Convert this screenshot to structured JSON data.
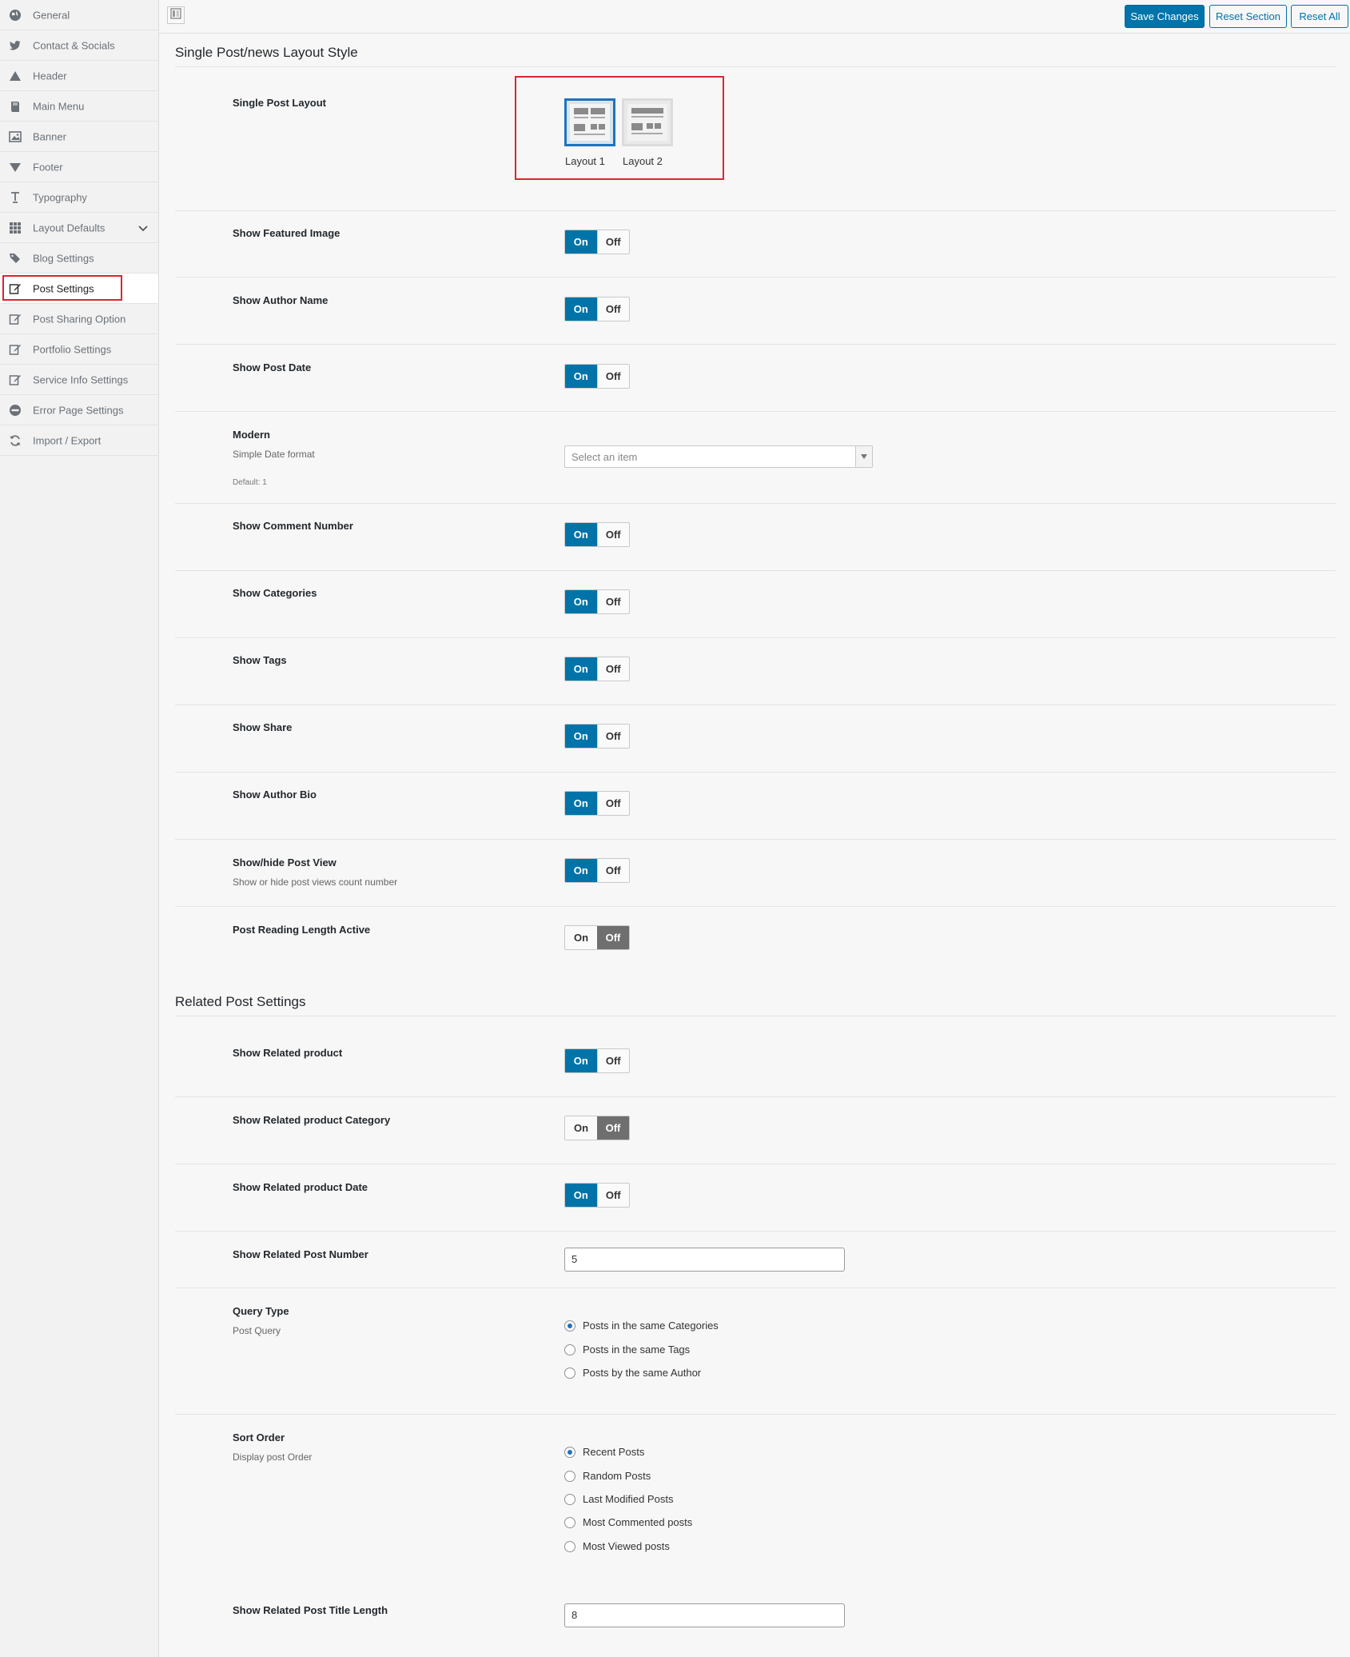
{
  "sidebar": {
    "items": [
      {
        "label": "General",
        "icon": "globe-icon"
      },
      {
        "label": "Contact & Socials",
        "icon": "twitter-icon"
      },
      {
        "label": "Header",
        "icon": "triangle-icon"
      },
      {
        "label": "Main Menu",
        "icon": "book-icon"
      },
      {
        "label": "Banner",
        "icon": "image-icon"
      },
      {
        "label": "Footer",
        "icon": "down-triangle-icon"
      },
      {
        "label": "Typography",
        "icon": "text-icon"
      },
      {
        "label": "Layout Defaults",
        "icon": "grid-icon"
      },
      {
        "label": "Blog Settings",
        "icon": "tags-icon"
      },
      {
        "label": "Post Settings",
        "icon": "edit-icon"
      },
      {
        "label": "Post Sharing Option",
        "icon": "edit-icon"
      },
      {
        "label": "Portfolio Settings",
        "icon": "edit-icon"
      },
      {
        "label": "Service Info Settings",
        "icon": "edit-icon"
      },
      {
        "label": "Error Page Settings",
        "icon": "minus-circle-icon"
      },
      {
        "label": "Import / Export",
        "icon": "refresh-icon"
      }
    ],
    "active_index": 9
  },
  "toolbar": {
    "save_label": "Save Changes",
    "reset_section_label": "Reset Section",
    "reset_all_label": "Reset All"
  },
  "section1": {
    "title": "Single Post/news Layout Style",
    "layout_label": "Single Post Layout",
    "layouts": [
      "Layout 1",
      "Layout 2"
    ],
    "selected_layout": 0,
    "date_format": {
      "label": "Modern",
      "sub": "Simple Date format",
      "default_note": "Default: 1",
      "placeholder": "Select an item"
    },
    "toggles": [
      {
        "label": "Show Featured Image",
        "on": true
      },
      {
        "label": "Show Author Name",
        "on": true
      },
      {
        "label": "Show Post Date",
        "on": true
      },
      {
        "label": "Show Comment Number",
        "on": true
      },
      {
        "label": "Show Categories",
        "on": true
      },
      {
        "label": "Show Tags",
        "on": true
      },
      {
        "label": "Show Share",
        "on": true
      },
      {
        "label": "Show Author Bio",
        "on": true
      },
      {
        "label": "Show/hide Post View",
        "sub": "Show or hide post views count number",
        "on": true
      },
      {
        "label": "Post Reading Length Active",
        "on": false
      }
    ]
  },
  "switch_labels": {
    "on": "On",
    "off": "Off"
  },
  "section2": {
    "title": "Related Post Settings",
    "toggles": [
      {
        "label": "Show Related product",
        "on": true
      },
      {
        "label": "Show Related product Category",
        "on": false
      },
      {
        "label": "Show Related product Date",
        "on": true
      }
    ],
    "post_number": {
      "label": "Show Related Post Number",
      "value": "5"
    },
    "query_type": {
      "label": "Query Type",
      "sub": "Post Query",
      "options": [
        "Posts in the same Categories",
        "Posts in the same Tags",
        "Posts by the same Author"
      ],
      "selected": 0
    },
    "sort_order": {
      "label": "Sort Order",
      "sub": "Display post Order",
      "options": [
        "Recent Posts",
        "Random Posts",
        "Last Modified Posts",
        "Most Commented posts",
        "Most Viewed posts"
      ],
      "selected": 0
    },
    "title_length": {
      "label": "Show Related Post Title Length",
      "value": "8"
    }
  },
  "colors": {
    "accent": "#0073aa",
    "switch_on": "#0074a8",
    "switch_off_active": "#6f6f6f",
    "highlight": "#d9262f"
  }
}
